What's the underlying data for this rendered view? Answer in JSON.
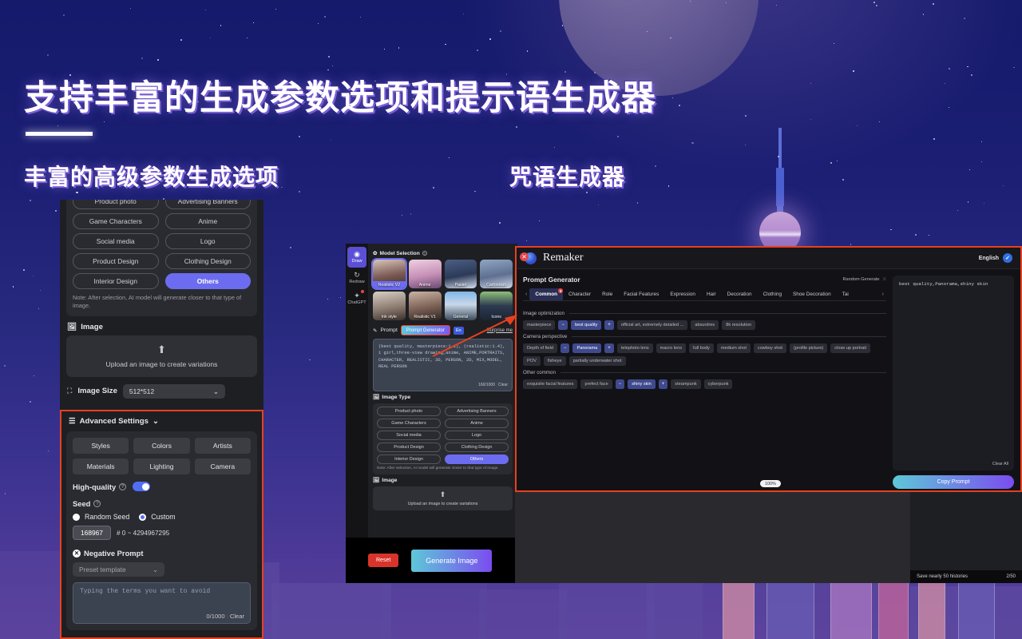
{
  "headings": {
    "title": "支持丰富的生成参数选项和提示语生成器",
    "sub_left": "丰富的高级参数生成选项",
    "sub_right": "咒语生成器"
  },
  "left_panel": {
    "image_type": {
      "chips": [
        "Product photo",
        "Advertising Banners",
        "Game Characters",
        "Anime",
        "Social media",
        "Logo",
        "Product Design",
        "Clothing Design",
        "Interior Design",
        "Others"
      ],
      "active": "Others",
      "note": "Note: After selection, AI model will generate closer to that type of image."
    },
    "image_label": "Image",
    "upload_text": "Upload an image to create variations",
    "image_size_label": "Image Size",
    "image_size_value": "512*512",
    "advanced": {
      "title": "Advanced Settings",
      "buttons": [
        "Styles",
        "Colors",
        "Artists",
        "Materials",
        "Lighting",
        "Camera"
      ],
      "high_quality_label": "High-quality",
      "high_quality_on": "on",
      "seed_label": "Seed",
      "seed_random_label": "Random Seed",
      "seed_custom_label": "Custom",
      "seed_value": "168967",
      "seed_range": "# 0 ~ 4294967295",
      "negative_prompt_label": "Negative Prompt",
      "preset_template": "Preset template",
      "negative_placeholder": "Typing the terms you want to avoid",
      "negative_count": "0/1000",
      "negative_clear": "Clear"
    }
  },
  "mid_window": {
    "nav": [
      {
        "label": "Draw",
        "glyph": "◉"
      },
      {
        "label": "Redraw",
        "glyph": "↻"
      },
      {
        "label": "ChatGPT",
        "glyph": "✦"
      }
    ],
    "model_selection_label": "Model Selection",
    "models": [
      {
        "name": "Realistic V2",
        "selected": true
      },
      {
        "name": "Anime",
        "selected": false
      },
      {
        "name": "Pastel",
        "selected": false
      },
      {
        "name": "Cartoonish",
        "selected": false
      },
      {
        "name": "Ink style",
        "selected": false
      },
      {
        "name": "Realistic V1",
        "selected": false
      },
      {
        "name": "General",
        "selected": false
      },
      {
        "name": "Icons",
        "selected": false
      }
    ],
    "prompt_label": "Prompt",
    "prompt_generator_button": "Prompt Generator",
    "lang_badge": "En",
    "surprise_me": "Surprise me",
    "prompt_text": "(best quality, masterpiece:1.1), (realistic:1.4), 1 girl,three-view drawing,anime, ANIME,PORTRAITS, CHARACTER, REALISTIC, 3D, PERSON, 2D, MIX,MODEL, REAL PERSON",
    "prompt_count": "160/1000",
    "prompt_clear": "Clear",
    "image_type_label": "Image Type",
    "image_type_chips": [
      "Product photo",
      "Advertising Banners",
      "Game Characters",
      "Anime",
      "Social media",
      "Logo",
      "Product Design",
      "Clothing Design",
      "Interior Design",
      "Others"
    ],
    "image_type_active": "Others",
    "image_type_note": "Note: After selection, AI model will generate closer to that type of image.",
    "image_label": "Image",
    "upload_text": "Upload an image to create variations",
    "reset_button": "Reset",
    "generate_button": "Generate Image"
  },
  "remaker": {
    "app_name": "Remaker",
    "language": "English",
    "panel_title": "Prompt Generator",
    "random_generate": "Random Generate",
    "tabs": [
      "Common",
      "Character",
      "Role",
      "Facial Features",
      "Expression",
      "Hair",
      "Decoration",
      "Clothing",
      "Shoe Decoration",
      "Tai"
    ],
    "active_tab": "Common",
    "active_tab_badge": "3",
    "groups": [
      {
        "name": "Image optimization",
        "tags": [
          {
            "label": "masterpiece",
            "selected": false
          },
          {
            "label": "best quality",
            "selected": true
          },
          {
            "label": "official art, extremely detailed ...",
            "selected": false
          },
          {
            "label": "absurdres",
            "selected": false
          },
          {
            "label": "8k resolution",
            "selected": false
          }
        ]
      },
      {
        "name": "Camera perspective",
        "tags": [
          {
            "label": "Depth of field",
            "selected": false
          },
          {
            "label": "Panorama",
            "selected": true
          },
          {
            "label": "telephoto lens",
            "selected": false
          },
          {
            "label": "macro lens",
            "selected": false
          },
          {
            "label": "full body",
            "selected": false
          },
          {
            "label": "medium shot",
            "selected": false
          },
          {
            "label": "cowboy shot",
            "selected": false
          },
          {
            "label": "(profile picture)",
            "selected": false
          },
          {
            "label": "close up portrait",
            "selected": false
          },
          {
            "label": "POV",
            "selected": false
          },
          {
            "label": "fisheye",
            "selected": false
          },
          {
            "label": "partially underwater shot",
            "selected": false
          }
        ]
      },
      {
        "name": "Other common",
        "tags": [
          {
            "label": "exquisite facial features",
            "selected": false
          },
          {
            "label": "prefect face",
            "selected": false
          },
          {
            "label": "shiny skin",
            "selected": true
          },
          {
            "label": "steampunk",
            "selected": false
          },
          {
            "label": "cyberpunk",
            "selected": false
          }
        ]
      }
    ],
    "output_text": "best quality,Panorama,shiny skin",
    "clear_all": "Clear All",
    "copy_prompt": "Copy Prompt",
    "zoom_level": "100%"
  },
  "browser": {
    "history_text": "Save nearly 50 histories",
    "history_count": "2/50"
  },
  "colors": {
    "accent_purple": "#6c6cf0",
    "annotation_red": "#e8401f",
    "danger_red": "#d9342b",
    "gradient_start": "#5ec8d8",
    "gradient_end": "#7b4cf0"
  }
}
